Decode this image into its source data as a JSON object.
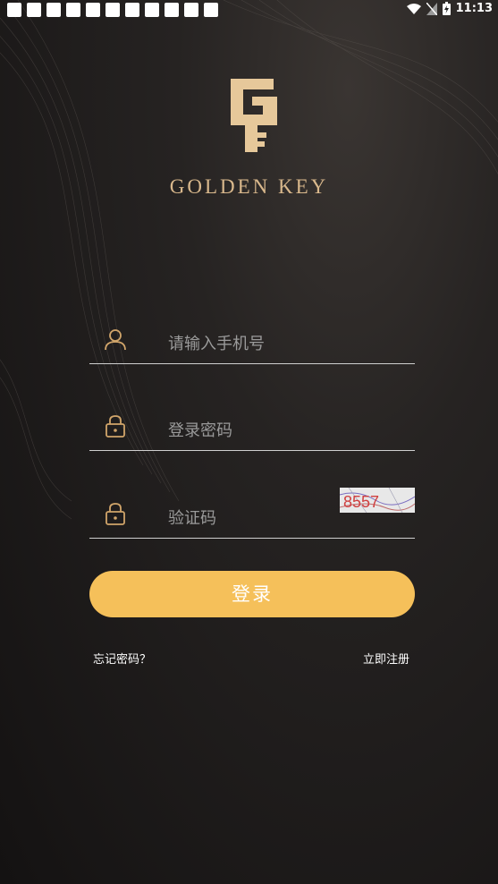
{
  "status_bar": {
    "time": "11:13"
  },
  "brand": {
    "name": "GOLDEN KEY"
  },
  "form": {
    "phone_placeholder": "请输入手机号",
    "password_placeholder": "登录密码",
    "captcha_placeholder": "验证码",
    "captcha_text": "8557"
  },
  "login_button": "登录",
  "links": {
    "forgot_password": "忘记密码？",
    "register": "立即注册"
  },
  "colors": {
    "accent": "#f5c05a",
    "brand_gold": "#d9b88c",
    "icon_gold": "#d1a56a"
  }
}
